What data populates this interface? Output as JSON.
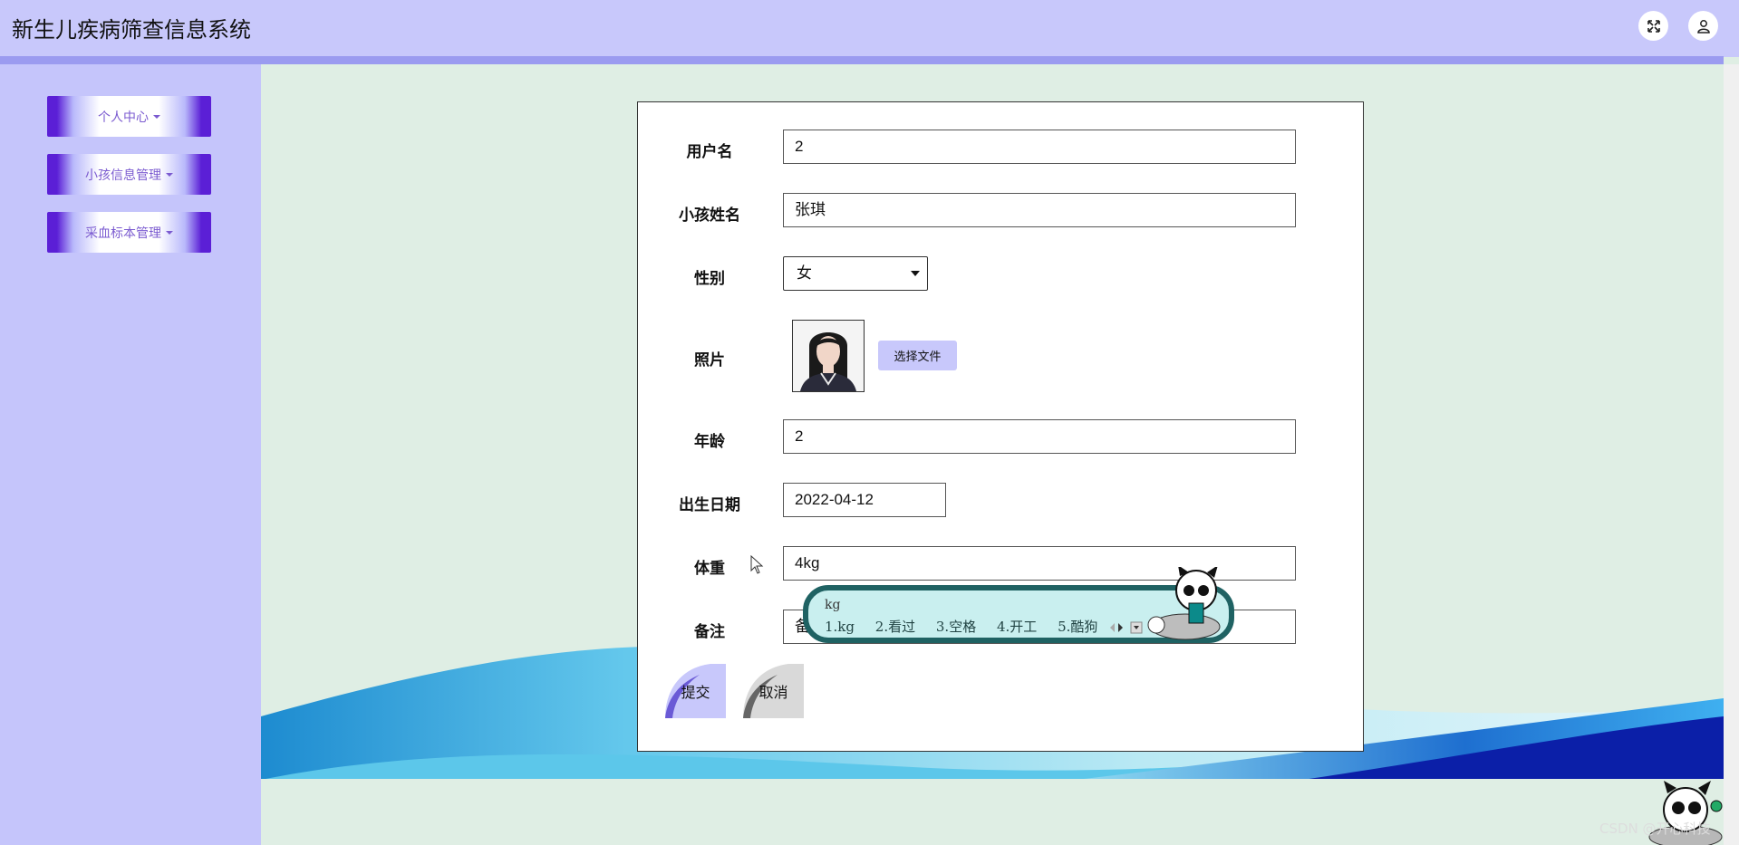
{
  "header": {
    "title": "新生儿疾病筛查信息系统",
    "fullscreen_icon": "expand-arrows-icon",
    "user_icon": "user-icon"
  },
  "sidebar": {
    "items": [
      {
        "label": "个人中心"
      },
      {
        "label": "小孩信息管理"
      },
      {
        "label": "采血标本管理"
      }
    ]
  },
  "form": {
    "username_label": "用户名",
    "username_value": "2",
    "childname_label": "小孩姓名",
    "childname_value": "张琪",
    "gender_label": "性别",
    "gender_value": "女",
    "photo_label": "照片",
    "file_button": "选择文件",
    "age_label": "年龄",
    "age_value": "2",
    "birth_label": "出生日期",
    "birth_value": "2022-04-12",
    "weight_label": "体重",
    "weight_value": "4kg",
    "note_label": "备注",
    "note_value": "备",
    "submit_label": "提交",
    "cancel_label": "取消"
  },
  "ime": {
    "composition": "kg",
    "candidates": [
      "1.kg",
      "2.看过",
      "3.空格",
      "4.开工",
      "5.酷狗"
    ]
  },
  "watermark": "CSDN @开心科技"
}
